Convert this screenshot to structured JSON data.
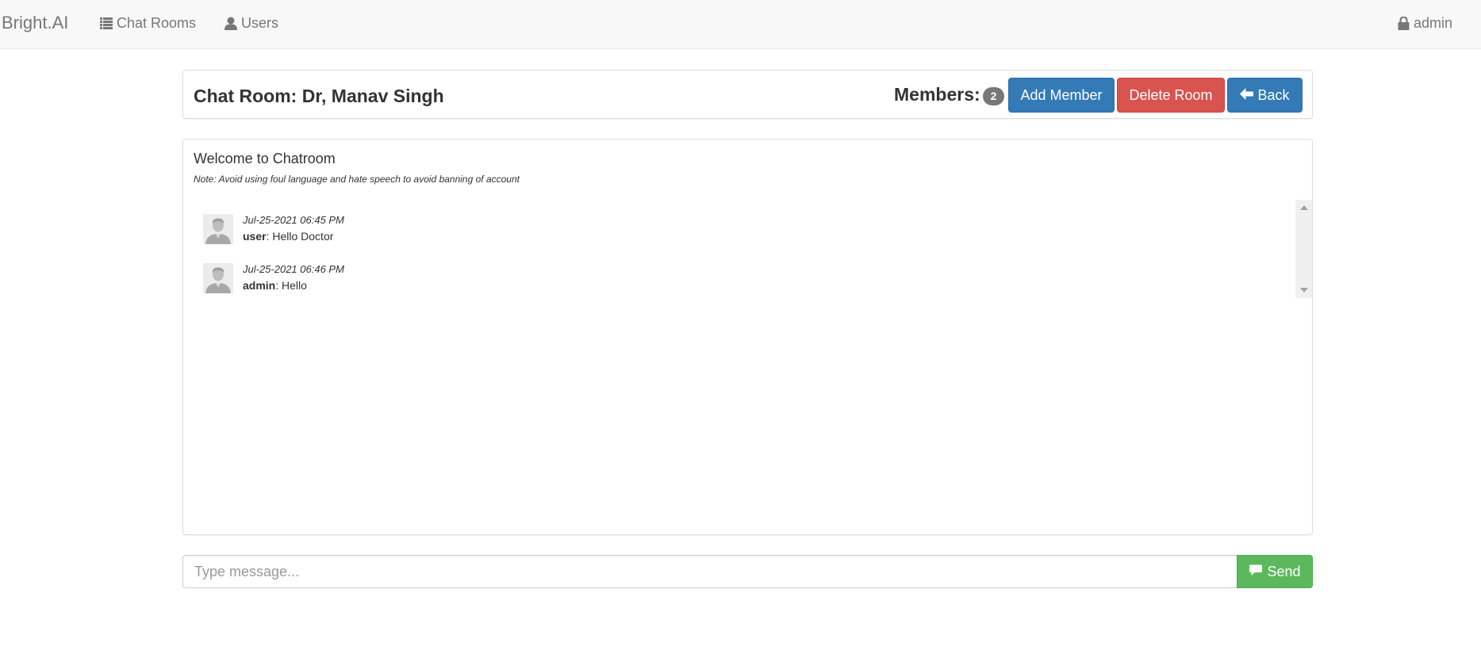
{
  "navbar": {
    "brand": "Bright.AI",
    "links": [
      {
        "label": "Chat Rooms",
        "icon": "list-icon"
      },
      {
        "label": "Users",
        "icon": "user-icon"
      }
    ],
    "account": {
      "label": "admin",
      "icon": "lock-icon"
    }
  },
  "room": {
    "title": "Chat Room: Dr, Manav Singh",
    "members_label": "Members:",
    "member_count": "2",
    "buttons": {
      "add_member": "Add Member",
      "delete_room": "Delete Room",
      "back": "Back"
    }
  },
  "chat": {
    "welcome": "Welcome to Chatroom",
    "note": "Note: Avoid using foul language and hate speech to avoid banning of account",
    "messages": [
      {
        "time": "Jul-25-2021 06:45 PM",
        "user": "user",
        "separator": ": ",
        "text": "Hello Doctor"
      },
      {
        "time": "Jul-25-2021 06:46 PM",
        "user": "admin",
        "separator": ": ",
        "text": "Hello"
      }
    ]
  },
  "composer": {
    "placeholder": "Type message...",
    "send_label": "Send"
  },
  "colors": {
    "primary": "#337ab7",
    "danger": "#d9534f",
    "success": "#5cb85c",
    "badge": "#777777",
    "navbar_bg": "#f8f8f8"
  }
}
